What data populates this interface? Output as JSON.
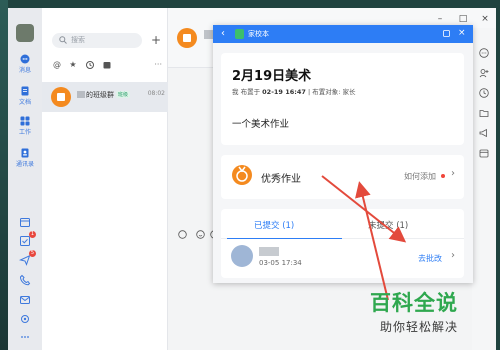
{
  "sidebar": {
    "items": [
      {
        "label": "消息",
        "icon": "chat-icon"
      },
      {
        "label": "文档",
        "icon": "document-icon"
      },
      {
        "label": "工作",
        "icon": "grid-icon"
      },
      {
        "label": "通讯录",
        "icon": "contacts-icon"
      }
    ],
    "badges": [
      "1",
      "5"
    ]
  },
  "chatlist": {
    "search_placeholder": "搜索",
    "add_label": "+",
    "more_label": "···",
    "item": {
      "name": "的班级群",
      "tag": "班级",
      "time": "08:02"
    }
  },
  "popup": {
    "title": "家校本",
    "homework": {
      "title": "2月19日美术",
      "meta_prefix": "我 布置于",
      "meta_time": "02-19 16:47",
      "meta_target": "| 布置对象: 家长",
      "body": "一个美术作业"
    },
    "excellent": {
      "title": "优秀作业",
      "how_add": "如何添加"
    },
    "tabs": {
      "submitted": "已提交 (1)",
      "unsubmitted": "未提交 (1)"
    },
    "submission": {
      "time": "03-05 17:34",
      "action": "去批改"
    }
  },
  "watermark": {
    "line1": "百科全说",
    "line2": "助你轻松解决"
  },
  "colors": {
    "accent": "#2d7df5",
    "orange": "#f48a1f",
    "red": "#e8473d",
    "arrow": "#e34a3c"
  }
}
